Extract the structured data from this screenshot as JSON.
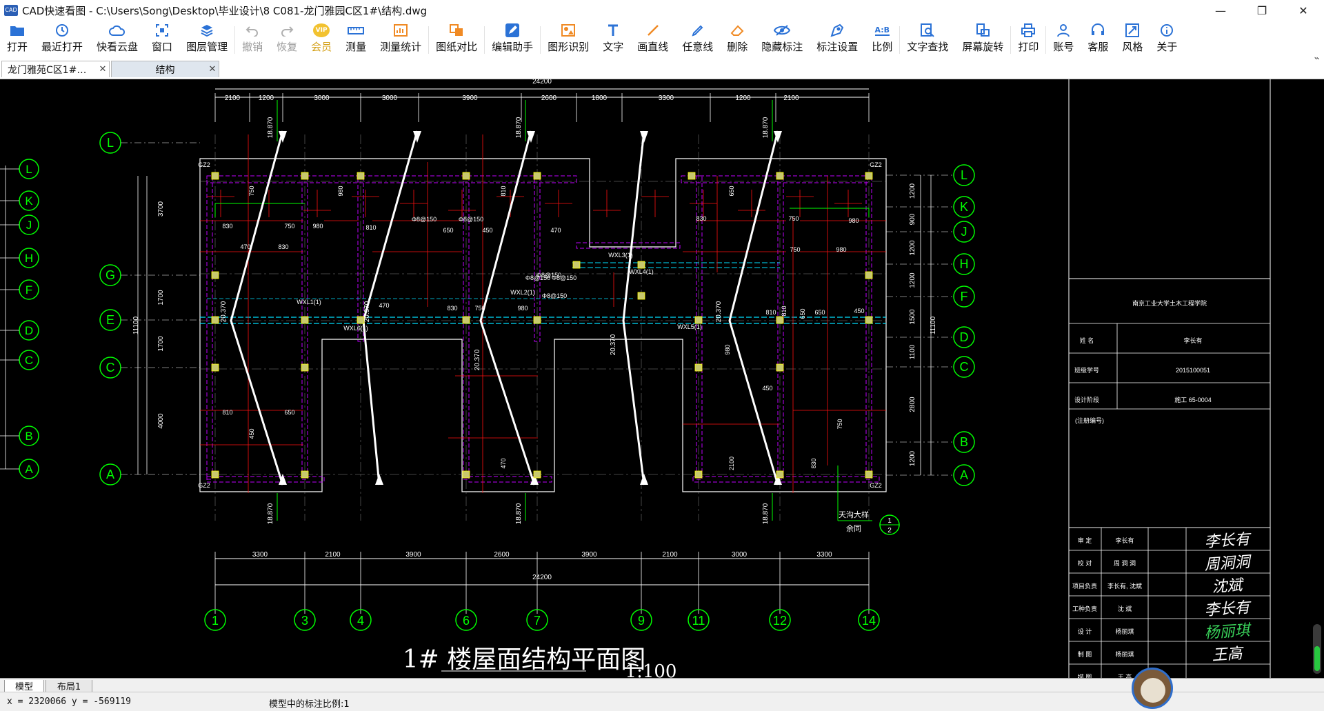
{
  "window": {
    "app_icon_text": "CAD",
    "title": "CAD快速看图 - C:\\Users\\Song\\Desktop\\毕业设计\\8 C081-龙门雅园C区1#\\结构.dwg",
    "minimize": "—",
    "maximize": "❐",
    "close": "✕"
  },
  "toolbar": {
    "items": [
      {
        "label": "打开",
        "icon": "folder-icon"
      },
      {
        "label": "最近打开",
        "icon": "clock-icon"
      },
      {
        "label": "快看云盘",
        "icon": "cloud-icon"
      },
      {
        "label": "窗口",
        "icon": "window-icon"
      },
      {
        "label": "图层管理",
        "icon": "layers-icon"
      },
      {
        "label": "撤销",
        "icon": "undo-icon"
      },
      {
        "label": "恢复",
        "icon": "redo-icon"
      },
      {
        "label": "会员",
        "icon": "vip-icon",
        "badge": "VIP"
      },
      {
        "label": "测量",
        "icon": "ruler-icon"
      },
      {
        "label": "测量统计",
        "icon": "measure-stats-icon"
      },
      {
        "label": "图纸对比",
        "icon": "compare-icon"
      },
      {
        "label": "编辑助手",
        "icon": "edit-assistant-icon"
      },
      {
        "label": "图形识别",
        "icon": "shape-recognize-icon"
      },
      {
        "label": "文字",
        "icon": "text-icon"
      },
      {
        "label": "画直线",
        "icon": "line-icon"
      },
      {
        "label": "任意线",
        "icon": "pen-icon"
      },
      {
        "label": "删除",
        "icon": "eraser-icon"
      },
      {
        "label": "隐藏标注",
        "icon": "eye-icon"
      },
      {
        "label": "标注设置",
        "icon": "dimension-settings-icon"
      },
      {
        "label": "比例",
        "icon": "scale-icon",
        "badge": "A:B"
      },
      {
        "label": "文字查找",
        "icon": "text-search-icon"
      },
      {
        "label": "屏幕旋转",
        "icon": "rotate-icon"
      },
      {
        "label": "打印",
        "icon": "printer-icon"
      },
      {
        "label": "账号",
        "icon": "user-icon"
      },
      {
        "label": "客服",
        "icon": "headset-icon"
      },
      {
        "label": "风格",
        "icon": "style-icon"
      },
      {
        "label": "关于",
        "icon": "info-icon"
      }
    ],
    "more": "»"
  },
  "tabs": [
    {
      "label": "龙门雅苑C区1#…",
      "close": "✕",
      "active": false
    },
    {
      "label": "结构",
      "close": "✕",
      "active": true
    }
  ],
  "drawing": {
    "top_dims": [
      "2100",
      "1200",
      "3000",
      "3000",
      "3900",
      "2600",
      "1800",
      "3300",
      "1200",
      "2100"
    ],
    "top_total": "24200",
    "bottom_dims": [
      "3300",
      "2100",
      "3900",
      "2600",
      "3900",
      "2100",
      "3000",
      "3300"
    ],
    "bottom_total": "24200",
    "col_axes": [
      "1",
      "3",
      "4",
      "6",
      "7",
      "9",
      "11",
      "12",
      "14"
    ],
    "row_axes_left": [
      "L",
      "G",
      "E",
      "C",
      "A"
    ],
    "row_axes_far_left": [
      "L",
      "K",
      "J",
      "H",
      "F",
      "D",
      "C",
      "B",
      "A"
    ],
    "row_axes_right": [
      "L",
      "K",
      "J",
      "H",
      "F",
      "D",
      "C",
      "B",
      "A"
    ],
    "left_dims": [
      "3700",
      "1700",
      "1700",
      "4000"
    ],
    "left_total": "11100",
    "right_dims": [
      "1200",
      "900",
      "1200",
      "1200",
      "1500",
      "1100",
      "2800",
      "1200"
    ],
    "right_total": "11100",
    "ridge_elev": "18.870",
    "eave_elev": "20.370",
    "gz_label": "GZ2",
    "beam_labels": [
      "WXL1(1)",
      "WXL2(1)",
      "WXL3(1)",
      "WXL4(1)",
      "WXL5(1)",
      "WXL6(1)"
    ],
    "rebar_labels": [
      "830",
      "750",
      "980",
      "810",
      "650",
      "450",
      "470",
      "2100",
      "1200",
      "Φ8@150"
    ],
    "note": "天沟大样",
    "note2": "余同",
    "detail_marker": [
      "1",
      "2"
    ],
    "drawing_title": "1# 楼屋面结构平面图",
    "scale": "1:100"
  },
  "title_block": {
    "school": "南京工业大学土木工程学院",
    "rows": [
      {
        "k": "姓 名",
        "v": "李长有"
      },
      {
        "k": "班级学号",
        "v": "2015100051"
      },
      {
        "k": "设计阶段",
        "v": "施工    65-0004"
      }
    ],
    "remark": "(注册编号)",
    "sign_rows": [
      {
        "k": "审 定",
        "v": "李长有"
      },
      {
        "k": "校 对",
        "v": "周 洞 洞"
      },
      {
        "k": "项目负责",
        "v": "李长有, 沈斌"
      },
      {
        "k": "工种负责",
        "v": "沈 斌"
      },
      {
        "k": "设 计",
        "v": "杨丽琪"
      },
      {
        "k": "制 图",
        "v": "杨丽琪"
      },
      {
        "k": "描 图",
        "v": "王 高"
      }
    ],
    "signatures": [
      "李长有",
      "周洞洞",
      "沈斌",
      "李长有",
      "杨丽琪",
      "王高"
    ]
  },
  "layout_tabs": [
    "模型",
    "布局1"
  ],
  "status": {
    "coords": "x = 2320066  y = -569119",
    "scale_text": "模型中的标注比例:1"
  },
  "colors": {
    "axis_green": "#00ff00",
    "dim_white": "#ffffff",
    "rebar_red": "#ff1010",
    "beam_magenta": "#c000ff",
    "cyan": "#00e0ff",
    "yellow": "#ffff00"
  }
}
